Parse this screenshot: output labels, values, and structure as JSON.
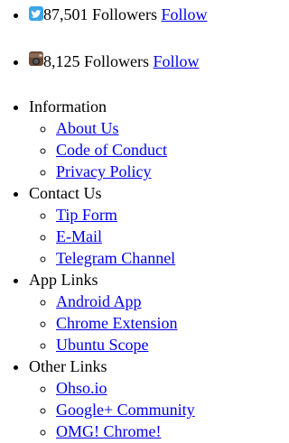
{
  "social": [
    {
      "icon": "twitter-icon",
      "followers_text": "87,501 Followers",
      "follow_label": "Follow",
      "icon_color": "#3aa6e6"
    },
    {
      "icon": "instagram-icon",
      "followers_text": "8,125 Followers",
      "follow_label": "Follow",
      "icon_color": "#6b4a36"
    }
  ],
  "sections": [
    {
      "title": "Information",
      "links": [
        "About Us",
        "Code of Conduct",
        "Privacy Policy"
      ]
    },
    {
      "title": "Contact Us",
      "links": [
        "Tip Form",
        "E-Mail",
        "Telegram Channel"
      ]
    },
    {
      "title": "App Links",
      "links": [
        "Android App",
        "Chrome Extension",
        "Ubuntu Scope"
      ]
    },
    {
      "title": "Other Links",
      "links": [
        "Ohso.io",
        "Google+ Community",
        "OMG! Chrome!"
      ]
    }
  ],
  "colors": {
    "link": "#0000ee",
    "text": "#000000"
  }
}
